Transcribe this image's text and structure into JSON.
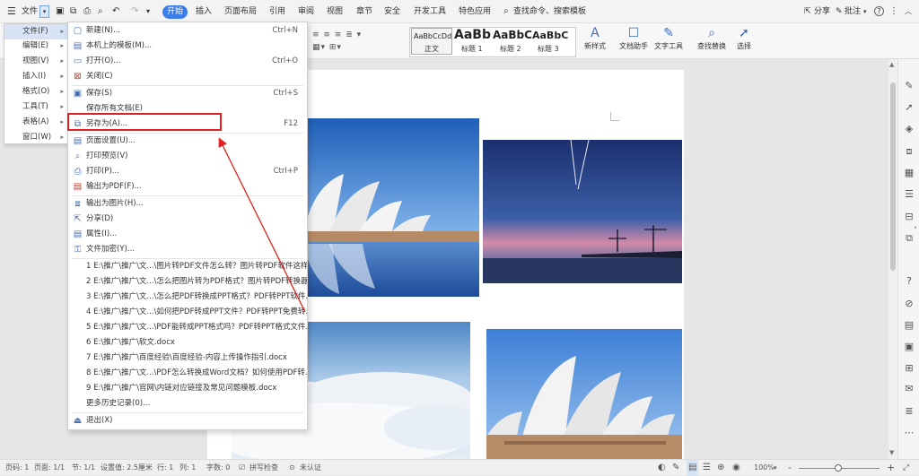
{
  "titlebar": {
    "menu_label": "文件",
    "tabs": [
      "开始",
      "插入",
      "页面布局",
      "引用",
      "审阅",
      "视图",
      "章节",
      "安全",
      "开发工具",
      "特色应用"
    ],
    "search": "查找命令、搜索模板",
    "share": "分享",
    "annotate": "批注",
    "help": "?"
  },
  "ribbon": {
    "styles": [
      {
        "sample": "AaBbCcDd",
        "label": "正文"
      },
      {
        "sample": "AaBb",
        "label": "标题 1"
      },
      {
        "sample": "AaBbC",
        "label": "标题 2"
      },
      {
        "sample": "AaBbC",
        "label": "标题 3"
      }
    ],
    "buttons": [
      "新样式",
      "文档助手",
      "文字工具",
      "查找替换",
      "选择"
    ]
  },
  "left_menu": {
    "items": [
      "文件(F)",
      "编辑(E)",
      "视图(V)",
      "插入(I)",
      "格式(O)",
      "工具(T)",
      "表格(A)",
      "窗口(W)"
    ]
  },
  "file_menu": {
    "items": [
      {
        "label": "新建(N)...",
        "shortcut": "Ctrl+N",
        "icon": "new-doc-icon"
      },
      {
        "label": "本机上的模板(M)...",
        "shortcut": "",
        "icon": "template-icon"
      },
      {
        "label": "打开(O)...",
        "shortcut": "Ctrl+O",
        "icon": "open-folder-icon"
      },
      {
        "label": "关闭(C)",
        "shortcut": "",
        "icon": "close-doc-icon"
      },
      {
        "label": "保存(S)",
        "shortcut": "Ctrl+S",
        "icon": "save-icon"
      },
      {
        "label": "保存所有文档(E)",
        "shortcut": "",
        "icon": ""
      },
      {
        "label": "另存为(A)...",
        "shortcut": "F12",
        "icon": "save-as-icon"
      },
      {
        "label": "页面设置(U)...",
        "shortcut": "",
        "icon": "page-setup-icon"
      },
      {
        "label": "打印预览(V)",
        "shortcut": "",
        "icon": "print-preview-icon"
      },
      {
        "label": "打印(P)...",
        "shortcut": "Ctrl+P",
        "icon": "print-icon"
      },
      {
        "label": "输出为PDF(F)...",
        "shortcut": "",
        "icon": "pdf-icon"
      },
      {
        "label": "输出为图片(H)...",
        "shortcut": "",
        "icon": "image-export-icon"
      },
      {
        "label": "分享(D)",
        "shortcut": "",
        "icon": "share-icon"
      },
      {
        "label": "属性(I)...",
        "shortcut": "",
        "icon": "properties-icon"
      },
      {
        "label": "文件加密(Y)...",
        "shortcut": "",
        "icon": "encrypt-icon"
      }
    ],
    "recent": [
      "1 E:\\推广\\推广\\文...\\图片转PDF文件怎么转？图片转PDF软件这样...",
      "2 E:\\推广\\推广\\文...\\怎么把图片转为PDF格式？图片转PDF转换器...",
      "3 E:\\推广\\推广\\文...\\怎么把PDF转换成PPT格式？PDF转PPT软件...",
      "4 E:\\推广\\推广\\文...\\如何把PDF转成PPT文件？PDF转PPT免费转...",
      "5 E:\\推广\\推广\\文...\\PDF能转成PPT格式吗？PDF转PPT格式文件...",
      "6 E:\\推广\\推广\\软文.docx",
      "7 E:\\推广\\推广\\百度经验\\百度经验-内容上传操作指引.docx",
      "8 E:\\推广\\推广\\文...\\PDF怎么转换成Word文档？如何使用PDF转...",
      "9 E:\\推广\\推广\\官网\\内链对应链接及常见问题模板.docx"
    ],
    "more_history": "更多历史记录(0)...",
    "exit": "退出(X)"
  },
  "statusbar": {
    "page_no": "页码: 1",
    "pages": "页面: 1/1",
    "section": "节: 1/1",
    "setting": "设置值: 2.5厘米",
    "row": "行: 1",
    "col": "列: 1",
    "words": "字数: 0",
    "spell": "拼写检查",
    "cert": "未认证",
    "zoom": "100%",
    "zoom_minus": "-",
    "zoom_plus": "+"
  },
  "colors": {
    "accent": "#3b7de9",
    "highlight_box": "#e02020",
    "menu_selected": "#d7e4f5"
  }
}
